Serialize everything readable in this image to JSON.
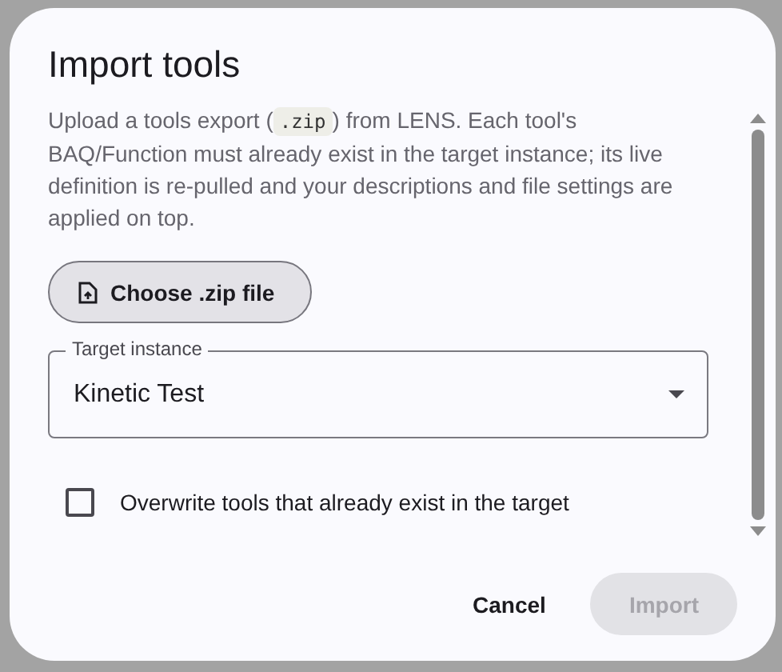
{
  "dialog": {
    "title": "Import tools",
    "description": {
      "before": "Upload a tools export (",
      "code": ".zip",
      "after": ") from LENS. Each tool's BAQ/Function must already exist in the target instance; its live definition is re-pulled and your descriptions and file settings are applied on top."
    },
    "file_button": {
      "label": "Choose .zip file"
    },
    "target_select": {
      "label": "Target instance",
      "value": "Kinetic Test"
    },
    "overwrite_checkbox": {
      "label": "Overwrite tools that already exist in the target",
      "checked": false
    },
    "actions": [
      {
        "label": "Cancel",
        "kind": "text",
        "disabled": false
      },
      {
        "label": "Import",
        "kind": "filled",
        "disabled": true
      }
    ]
  }
}
